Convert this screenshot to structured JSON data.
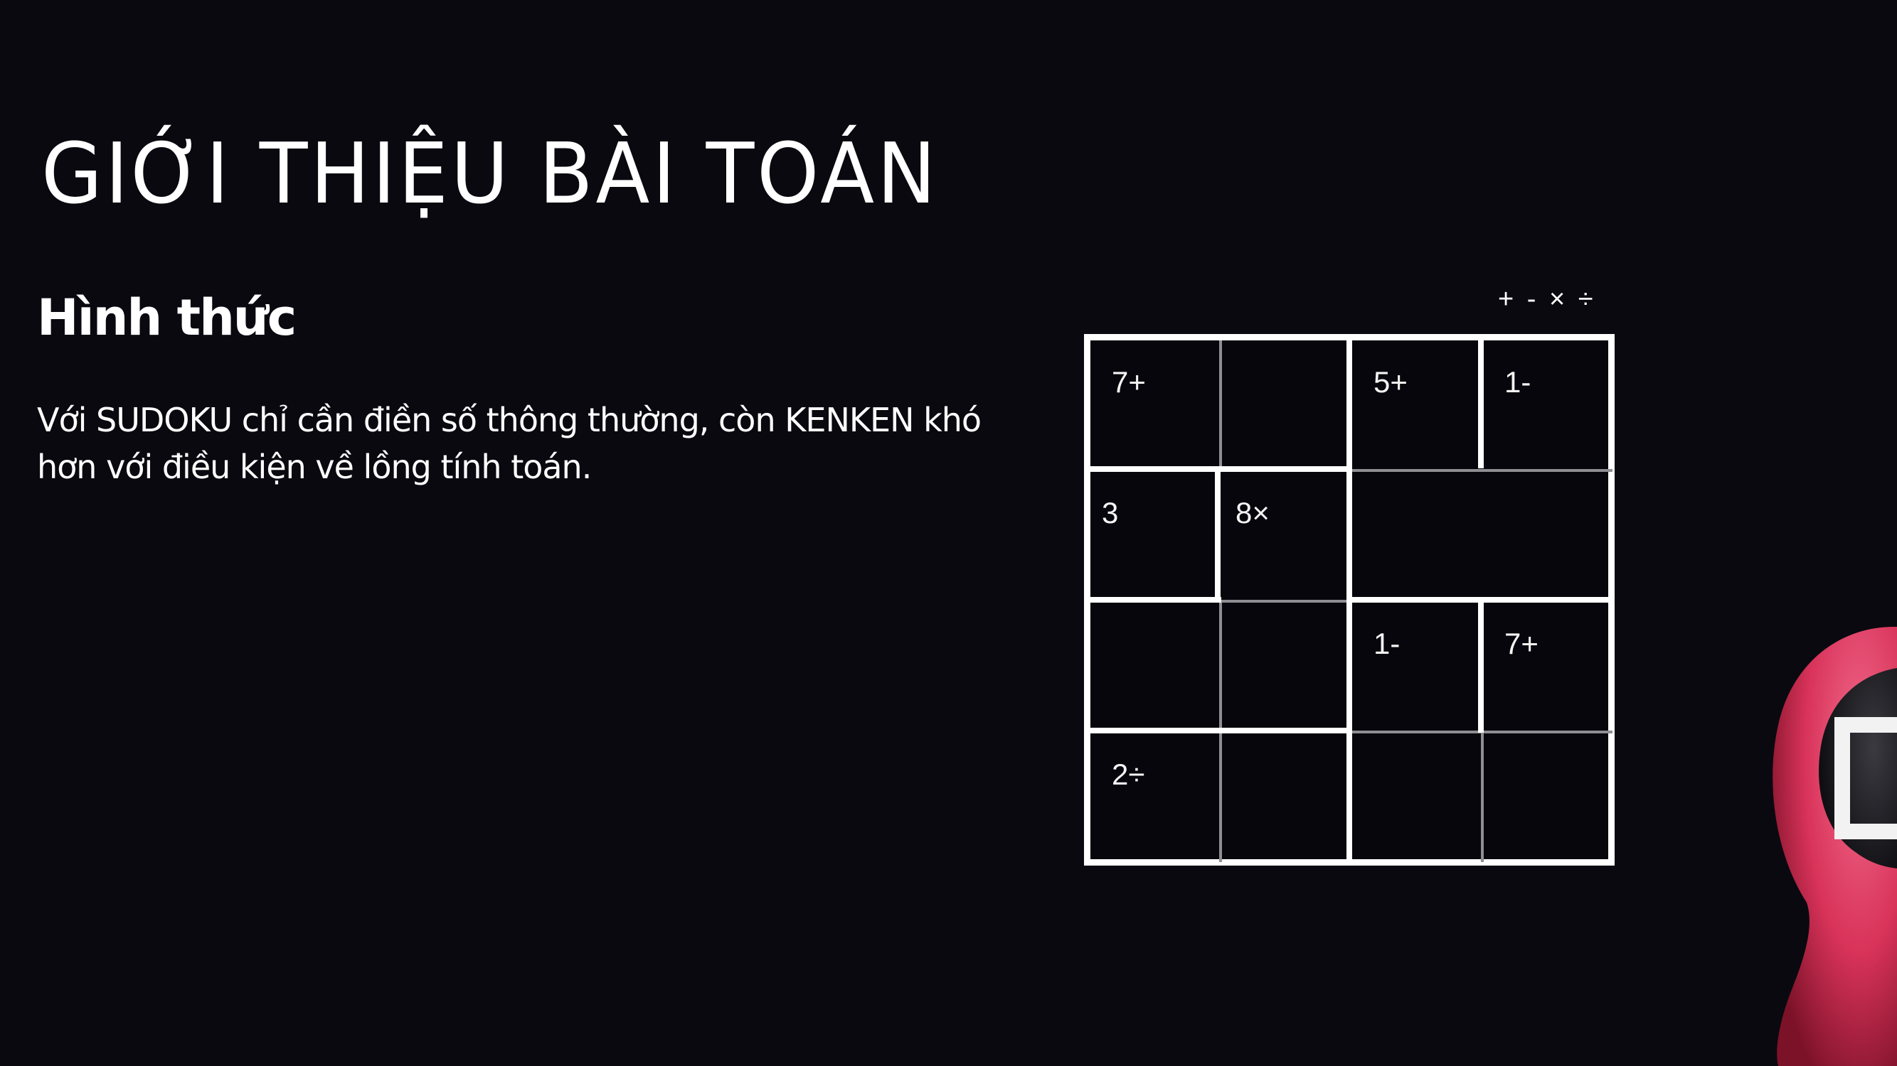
{
  "slide": {
    "title": "GIỚI THIỆU BÀI TOÁN",
    "subtitle": "Hình thức",
    "body_lines": [
      "Với SUDOKU chỉ cần điền số thông thường, còn KENKEN khó",
      "hơn với điều kiện về lồng tính toán."
    ]
  },
  "operators": "+ - × ÷",
  "kenken": {
    "size": 4,
    "cells": [
      [
        "7+",
        "",
        "5+",
        "1-"
      ],
      [
        "3",
        "8×",
        "",
        ""
      ],
      [
        "",
        "",
        "1-",
        "7+"
      ],
      [
        "2÷",
        "",
        "",
        ""
      ]
    ]
  },
  "mascot": {
    "icon": "squid-game-guard-mask-icon",
    "colors": {
      "hood": "#e0355f",
      "mask": "#1b1b1f",
      "symbol": "#ffffff"
    }
  },
  "colors": {
    "background": "#0a0910",
    "text": "#ffffff",
    "grid_line": "#ffffff",
    "thin_line": "#8e8e93"
  }
}
